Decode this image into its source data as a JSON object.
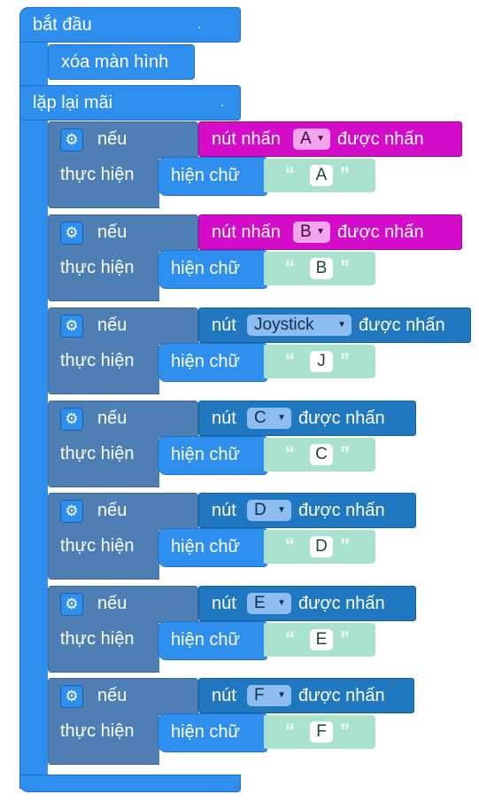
{
  "start_label": "bắt đầu",
  "start_dot": ".",
  "clear_label": "xóa màn hình",
  "loop_label": "lặp lại mãi",
  "loop_dot": ".",
  "if_label": "nếu",
  "do_label": "thực hiện",
  "show_label": "hiện chữ",
  "quote_open": "“",
  "quote_close": "”",
  "pressed_label": "được nhấn",
  "gear_icon": "⚙",
  "dropdown_icon": "▼",
  "handlers": [
    {
      "prefix": "nút nhấn",
      "button": "A",
      "text": "A",
      "color": "#d40bc9"
    },
    {
      "prefix": "nút nhấn",
      "button": "B",
      "text": "B",
      "color": "#d40bc9"
    },
    {
      "prefix": "nút",
      "button": "Joystick",
      "text": "J",
      "color": "#1f78c0"
    },
    {
      "prefix": "nút",
      "button": "C",
      "text": "C",
      "color": "#1f78c0"
    },
    {
      "prefix": "nút",
      "button": "D",
      "text": "D",
      "color": "#1f78c0"
    },
    {
      "prefix": "nút",
      "button": "E",
      "text": "E",
      "color": "#1f78c0"
    },
    {
      "prefix": "nút",
      "button": "F",
      "text": "F",
      "color": "#1f78c0"
    }
  ]
}
